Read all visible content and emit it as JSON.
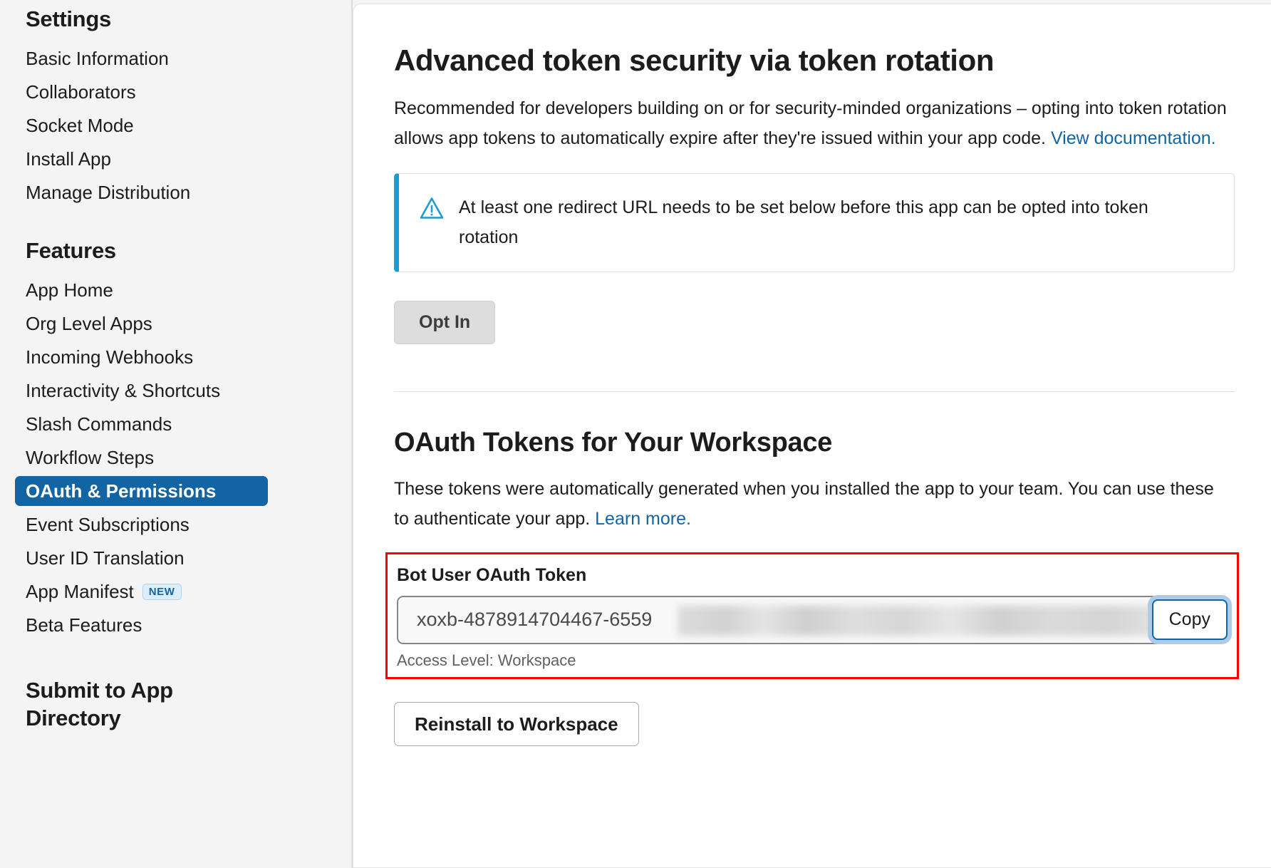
{
  "sidebar": {
    "groups": [
      {
        "heading": "Settings",
        "items": [
          {
            "label": "Basic Information",
            "selected": false,
            "badge": null
          },
          {
            "label": "Collaborators",
            "selected": false,
            "badge": null
          },
          {
            "label": "Socket Mode",
            "selected": false,
            "badge": null
          },
          {
            "label": "Install App",
            "selected": false,
            "badge": null
          },
          {
            "label": "Manage Distribution",
            "selected": false,
            "badge": null
          }
        ]
      },
      {
        "heading": "Features",
        "items": [
          {
            "label": "App Home",
            "selected": false,
            "badge": null
          },
          {
            "label": "Org Level Apps",
            "selected": false,
            "badge": null
          },
          {
            "label": "Incoming Webhooks",
            "selected": false,
            "badge": null
          },
          {
            "label": "Interactivity & Shortcuts",
            "selected": false,
            "badge": null
          },
          {
            "label": "Slash Commands",
            "selected": false,
            "badge": null
          },
          {
            "label": "Workflow Steps",
            "selected": false,
            "badge": null
          },
          {
            "label": "OAuth & Permissions",
            "selected": true,
            "badge": null
          },
          {
            "label": "Event Subscriptions",
            "selected": false,
            "badge": null
          },
          {
            "label": "User ID Translation",
            "selected": false,
            "badge": null
          },
          {
            "label": "App Manifest",
            "selected": false,
            "badge": "NEW"
          },
          {
            "label": "Beta Features",
            "selected": false,
            "badge": null
          }
        ]
      },
      {
        "heading": "Submit to App Directory",
        "items": []
      }
    ]
  },
  "token_rotation": {
    "title": "Advanced token security via token rotation",
    "description_before_link": "Recommended for developers building on or for security-minded organizations – opting into token rotation allows app tokens to automatically expire after they're issued within your app code. ",
    "description_link": "View documentation.",
    "alert": {
      "icon": "warning-triangle-icon",
      "message": "At least one redirect URL needs to be set below before this app can be opted into token rotation"
    },
    "opt_in_label": "Opt In"
  },
  "oauth_tokens": {
    "title": "OAuth Tokens for Your Workspace",
    "description_before_link": "These tokens were automatically generated when you installed the app to your team. You can use these to authenticate your app. ",
    "description_link": "Learn more.",
    "bot_token_label": "Bot User OAuth Token",
    "bot_token_value": "xoxb-4878914704467-6559",
    "copy_label": "Copy",
    "access_level": "Access Level: Workspace",
    "reinstall_label": "Reinstall to Workspace"
  },
  "colors": {
    "accent_blue": "#1264a3",
    "alert_blue": "#1d9bd1",
    "highlight_red": "#ff0000",
    "sidebar_bg": "#f4f4f4",
    "card_bg": "#ffffff"
  }
}
